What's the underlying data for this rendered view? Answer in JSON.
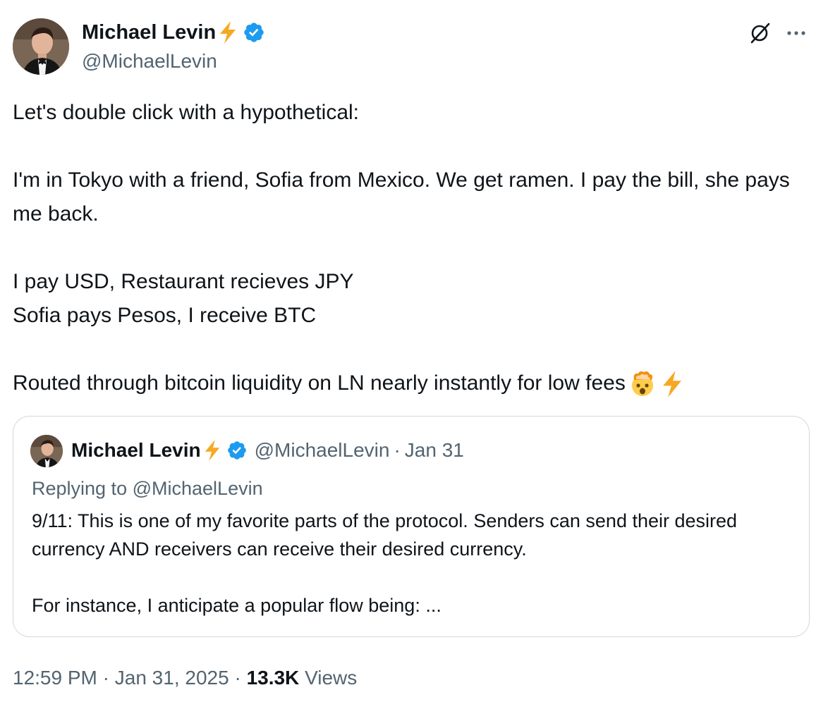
{
  "author": {
    "name": "Michael Levin",
    "handle": "@MichaelLevin"
  },
  "tweet": {
    "lines": [
      "Let's double click with a hypothetical:",
      "I'm in Tokyo with a friend, Sofia from Mexico. We get ramen. I pay the bill, she pays me back.",
      "I pay USD, Restaurant recieves JPY",
      "Sofia pays Pesos, I receive BTC",
      "Routed through bitcoin liquidity on LN nearly instantly for low fees"
    ],
    "emoji": [
      "exploding-head-emoji",
      "lightning-emoji"
    ]
  },
  "quote": {
    "author_name": "Michael Levin",
    "handle": "@MichaelLevin",
    "separator": "·",
    "date": "Jan 31",
    "replying_prefix": "Replying to",
    "replying_handle": "@MichaelLevin",
    "text_lines": [
      "9/11: This is one of my favorite parts of the protocol. Senders can send their desired currency AND receivers can receive their desired currency.",
      "For instance, I anticipate a popular flow being: ..."
    ]
  },
  "meta": {
    "time": "12:59 PM",
    "separator": "·",
    "date": "Jan 31, 2025",
    "views_count": "13.3K",
    "views_label": "Views"
  },
  "colors": {
    "text": "#0f1419",
    "secondary": "#536471",
    "verified": "#1d9bf0",
    "bolt": "#f7a823",
    "border": "#cfd9de"
  }
}
